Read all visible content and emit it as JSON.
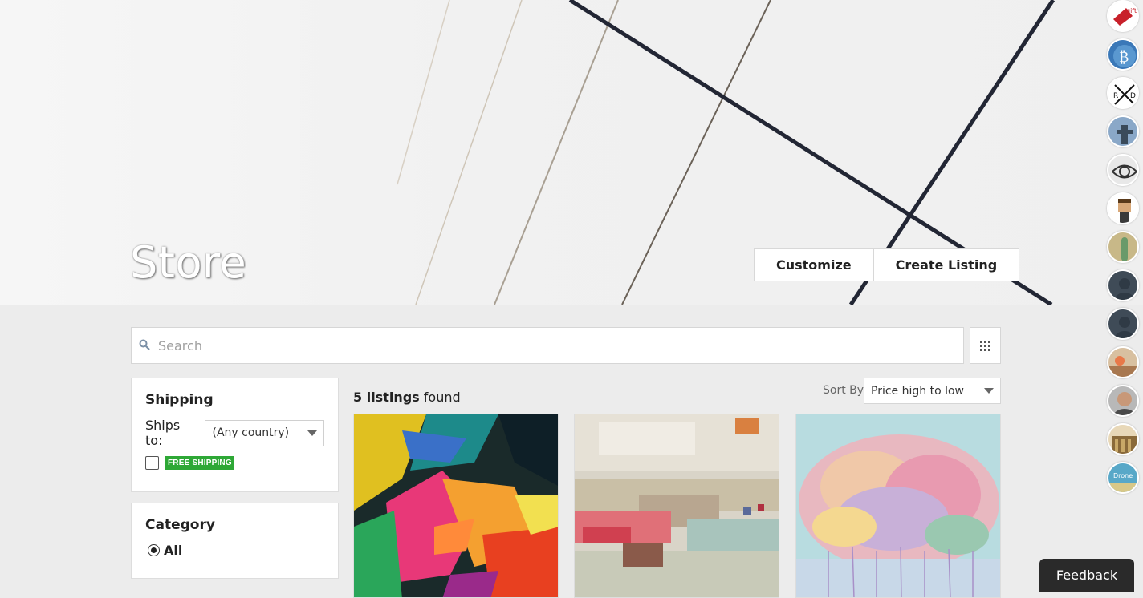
{
  "hero": {
    "title": "Store",
    "customize_label": "Customize",
    "create_listing_label": "Create Listing"
  },
  "search": {
    "placeholder": "Search",
    "icon": "search-icon",
    "view_toggle_icon": "grid-icon"
  },
  "filters": {
    "shipping": {
      "heading": "Shipping",
      "ships_to_label": "Ships to:",
      "ships_to_value": "(Any country)",
      "free_shipping_badge": "FREE SHIPPING",
      "free_shipping_checked": false
    },
    "category": {
      "heading": "Category",
      "options": [
        {
          "label": "All",
          "selected": true
        }
      ]
    }
  },
  "listings": {
    "count_text": "5 listings",
    "found_text": "found",
    "sort_label": "Sort By",
    "sort_value": "Price high to low",
    "cards": [
      {
        "image": "colorful-portrait-painting"
      },
      {
        "image": "abstract-painting"
      },
      {
        "image": "flower-dot-painting"
      }
    ]
  },
  "side_avatars": [
    "gift-card-store-avatar",
    "bitcoin-avatar",
    "rd-logo-avatar",
    "statue-avatar",
    "pattern-avatar",
    "pixel-character-avatar",
    "cactus-avatar",
    "default-user-avatar",
    "default-user-avatar",
    "photo-avatar",
    "man-avatar",
    "library-avatar",
    "drone-surplus-avatar"
  ],
  "feedback_label": "Feedback",
  "colors": {
    "free_shipping_badge": "#2ea836",
    "feedback_bg": "#2a2a2a",
    "page_bg": "#ececec"
  }
}
